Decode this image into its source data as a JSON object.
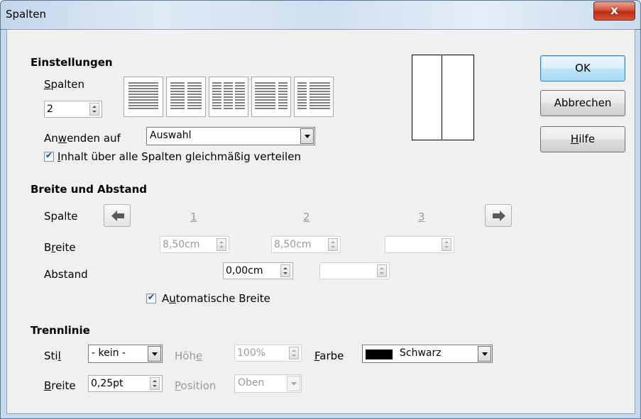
{
  "window": {
    "title": "Spalten",
    "close_glyph": "x"
  },
  "settings": {
    "heading": "Einstellungen",
    "columns_label": "Spalten",
    "columns_value": "2",
    "apply_label": "Anwenden auf",
    "apply_value": "Auswahl",
    "distribute_label": "Inhalt über alle Spalten gleichmäßig verteilen",
    "distribute_checked": true
  },
  "width_spacing": {
    "heading": "Breite und Abstand",
    "column_label": "Spalte",
    "col_numbers": [
      "1",
      "2",
      "3"
    ],
    "width_label": "Breite",
    "widths": [
      "8,50cm",
      "8,50cm",
      ""
    ],
    "spacing_label": "Abstand",
    "spacings": [
      "0,00cm",
      ""
    ],
    "autowidth_label": "Automatische Breite",
    "autowidth_checked": true
  },
  "separator": {
    "heading": "Trennlinie",
    "style_label": "Stil",
    "style_value": "- kein -",
    "height_label": "Höhe",
    "height_value": "100%",
    "color_label": "Farbe",
    "color_value": "Schwarz",
    "color_hex": "#000000",
    "width_label": "Breite",
    "width_value": "0,25pt",
    "position_label": "Position",
    "position_value": "Oben"
  },
  "buttons": {
    "ok": "OK",
    "cancel": "Abbrechen",
    "help": "Hilfe"
  },
  "icons": {
    "left": "arrow-left-icon",
    "right": "arrow-right-icon",
    "close": "close-icon"
  }
}
